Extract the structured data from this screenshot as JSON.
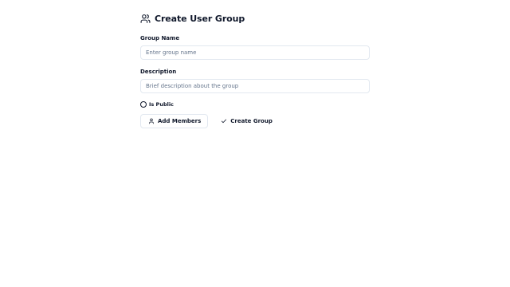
{
  "form": {
    "title": "Create User Group",
    "title_icon": "users-icon",
    "group_name": {
      "label": "Group Name",
      "placeholder": "Enter group name",
      "value": ""
    },
    "description": {
      "label": "Description",
      "placeholder": "Brief description about the group",
      "value": ""
    },
    "is_public": {
      "label": "Is Public",
      "checked": false
    },
    "buttons": {
      "add_members": {
        "label": "Add Members",
        "icon": "user-icon"
      },
      "create_group": {
        "label": "Create Group",
        "icon": "check-icon"
      }
    }
  },
  "colors": {
    "text": "#0f172a",
    "muted": "#64748b",
    "border": "#e2e8f0",
    "background": "#ffffff"
  }
}
